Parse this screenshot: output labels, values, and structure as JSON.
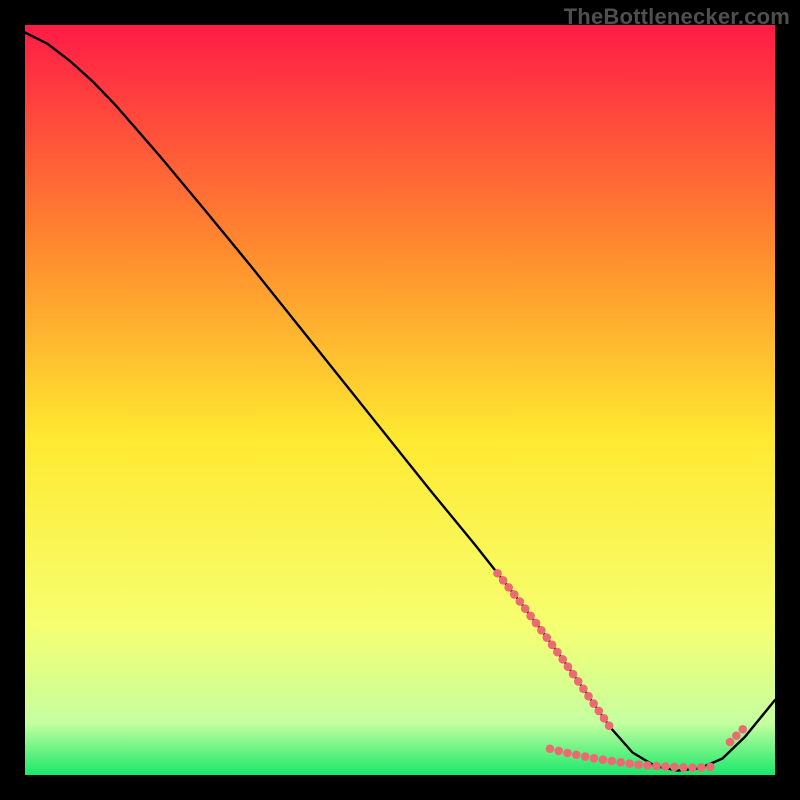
{
  "watermark": "TheBottlenecker.com",
  "chart_data": {
    "type": "line",
    "title": "",
    "xlabel": "",
    "ylabel": "",
    "xlim": [
      0,
      100
    ],
    "ylim": [
      0,
      100
    ],
    "grid": false,
    "legend": false,
    "background_gradient": {
      "top": "#ff1b46",
      "mid_upper": "#ff8b2e",
      "mid": "#ffe931",
      "mid_lower": "#f6ff70",
      "lower": "#c6ffa0",
      "bottom": "#19e86b"
    },
    "series": [
      {
        "name": "curve",
        "color": "#000000",
        "x": [
          0,
          3,
          6,
          9,
          12,
          18,
          24,
          30,
          36,
          42,
          48,
          54,
          60,
          63,
          66,
          69,
          72,
          75,
          78,
          81,
          84,
          87,
          90,
          93,
          96,
          100
        ],
        "y": [
          99,
          97.5,
          95.2,
          92.5,
          89.4,
          82.5,
          75.3,
          68.0,
          60.5,
          53.0,
          45.5,
          38.0,
          30.7,
          26.9,
          23.1,
          19.1,
          15.0,
          10.7,
          6.4,
          3.0,
          1.2,
          0.6,
          0.9,
          2.2,
          5.1,
          10.0
        ]
      }
    ],
    "dotted_segments": [
      {
        "x": [
          63,
          66,
          69,
          72,
          75,
          78
        ],
        "y": [
          26.9,
          23.1,
          19.1,
          15.0,
          10.7,
          6.4
        ]
      },
      {
        "x": [
          70,
          72,
          74,
          76,
          78,
          80,
          82,
          84,
          86,
          88,
          90,
          92
        ],
        "y": [
          3.5,
          3.0,
          2.6,
          2.2,
          1.9,
          1.6,
          1.35,
          1.2,
          1.1,
          1.0,
          1.0,
          1.1
        ]
      },
      {
        "x": [
          94,
          95,
          96
        ],
        "y": [
          4.4,
          5.4,
          6.4
        ]
      }
    ],
    "dot_color": "#ed6a72"
  }
}
